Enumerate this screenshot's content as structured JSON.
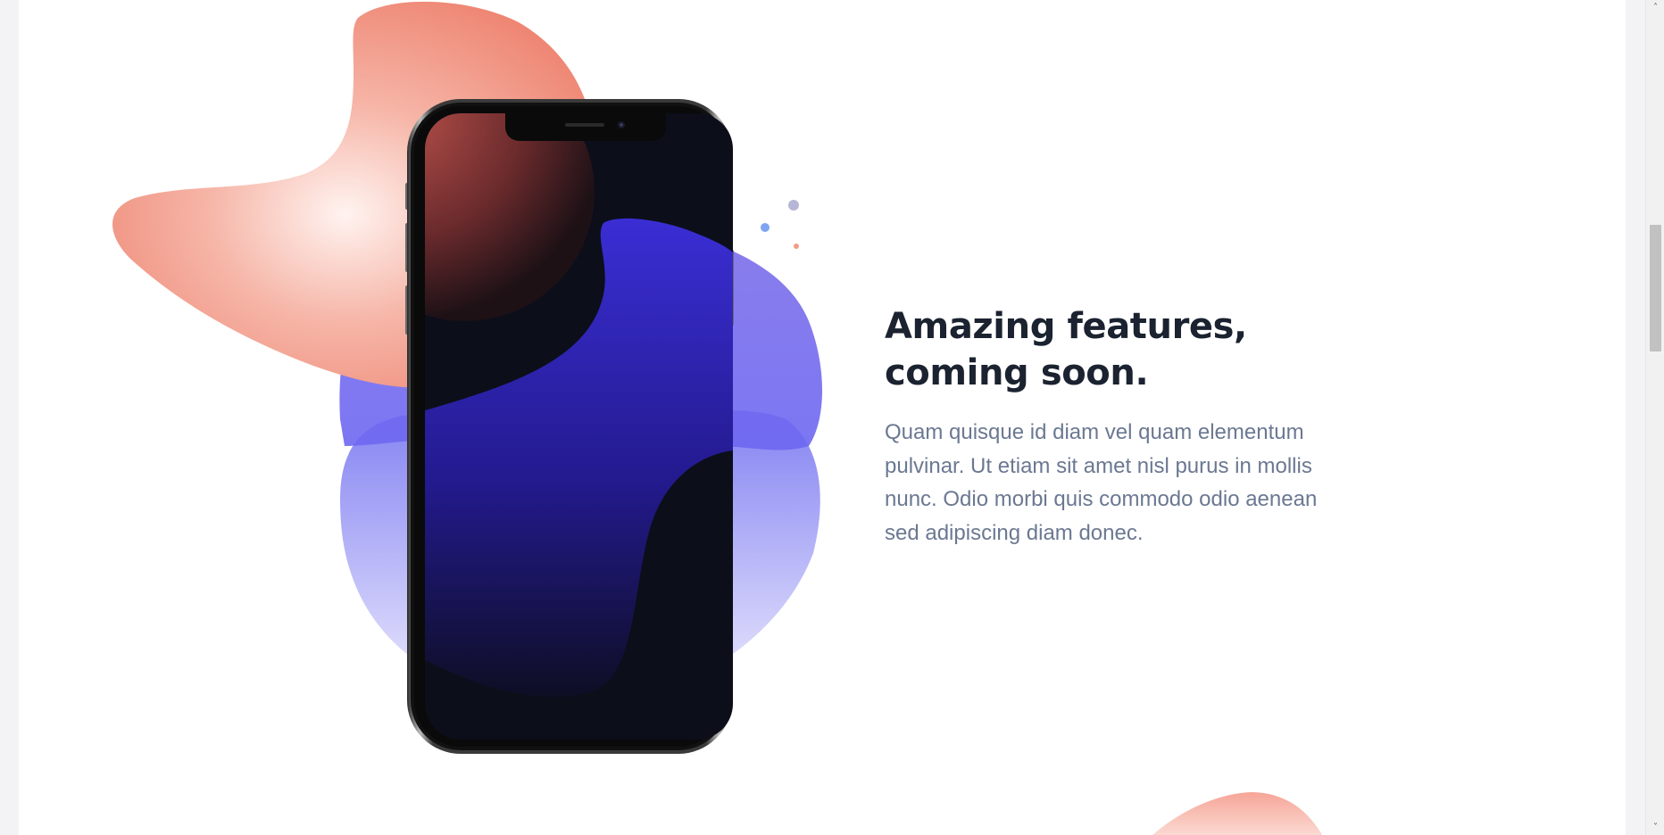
{
  "feature": {
    "headline_line1": "Amazing features,",
    "headline_line2": "coming soon.",
    "body": "Quam quisque id diam vel quam elementum pulvinar. Ut etiam sit amet nisl purus in mollis nunc. Odio morbi quis commodo odio aenean sed adipiscing diam donec."
  },
  "scrollbar": {
    "up_arrow": "˄",
    "down_arrow": "˅"
  },
  "colors": {
    "headline": "#1b2230",
    "body": "#6b7891",
    "blob_coral": "#f4a294",
    "blob_indigo": "#6f66ee",
    "phone_screen": "#0c0e1a",
    "phone_wave": "#3a2ed4"
  },
  "icons": {
    "phone": "smartphone-mockup",
    "decor_dots": "dots"
  }
}
